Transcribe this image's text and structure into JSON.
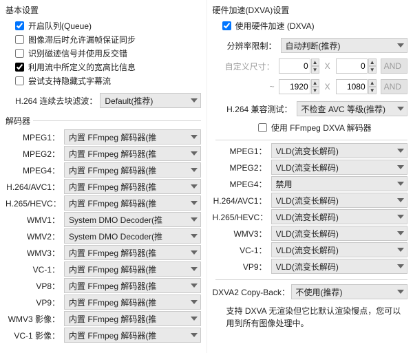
{
  "left": {
    "basic_title": "基本设置",
    "chk_queue": "开启队列(Queue)",
    "chk_framedrop": "图像滞后时允许漏帧保证同步",
    "chk_magnetics": "识别磁迹信号并使用反交错",
    "chk_highbit": "利用流中所定义的宽高比信息",
    "chk_hidden_sub": "尝试支持隐藏式字幕流",
    "label_deblock": "H.264 连续去块滤波：",
    "val_deblock": "Default(推荐)",
    "decoder_title": "解码器",
    "rows": [
      {
        "label": "MPEG1：",
        "val": "内置 FFmpeg 解码器(推"
      },
      {
        "label": "MPEG2：",
        "val": "内置 FFmpeg 解码器(推"
      },
      {
        "label": "MPEG4：",
        "val": "内置 FFmpeg 解码器(推"
      },
      {
        "label": "H.264/AVC1：",
        "val": "内置 FFmpeg 解码器(推"
      },
      {
        "label": "H.265/HEVC：",
        "val": "内置 FFmpeg 解码器(推"
      },
      {
        "label": "WMV1：",
        "val": "System DMO Decoder(推"
      },
      {
        "label": "WMV2：",
        "val": "System DMO Decoder(推"
      },
      {
        "label": "WMV3：",
        "val": "内置 FFmpeg 解码器(推"
      },
      {
        "label": "VC-1：",
        "val": "内置 FFmpeg 解码器(推"
      },
      {
        "label": "VP8：",
        "val": "内置 FFmpeg 解码器(推"
      },
      {
        "label": "VP9：",
        "val": "内置 FFmpeg 解码器(推"
      },
      {
        "label": "WMV3 影像：",
        "val": "内置 FFmpeg 解码器(推"
      },
      {
        "label": "VC-1 影像：",
        "val": "内置 FFmpeg 解码器(推"
      }
    ]
  },
  "right": {
    "dxva_title": "硬件加速(DXVA)设置",
    "chk_dxva": "使用硬件加速 (DXVA)",
    "label_reslimit": "分辨率限制：",
    "val_reslimit": "自动判断(推荐)",
    "label_customsize": "自定义尺寸：",
    "size_min_w": "0",
    "size_min_h": "0",
    "tilde": "~",
    "size_max_w": "1920",
    "size_max_h": "1080",
    "and_label": "AND",
    "x_label": "X",
    "label_compat": "H.264 兼容测试：",
    "val_compat": "不检查 AVC 等级(推荐)",
    "chk_ffmpeg_dxva": "使用 FFmpeg DXVA 解码器",
    "rows": [
      {
        "label": "MPEG1：",
        "val": "VLD(流变长解码)"
      },
      {
        "label": "MPEG2：",
        "val": "VLD(流变长解码)"
      },
      {
        "label": "MPEG4：",
        "val": "禁用"
      },
      {
        "label": "H.264/AVC1：",
        "val": "VLD(流变长解码)"
      },
      {
        "label": "H.265/HEVC：",
        "val": "VLD(流变长解码)"
      },
      {
        "label": "WMV3：",
        "val": "VLD(流变长解码)"
      },
      {
        "label": "VC-1：",
        "val": "VLD(流变长解码)"
      },
      {
        "label": "VP9：",
        "val": "VLD(流变长解码)"
      }
    ],
    "label_copyback": "DXVA2 Copy-Back：",
    "val_copyback": "不使用(推荐)",
    "hint": "支持 DXVA 无渲染但它比默认渲染慢点，您可以用到所有图像处理中。"
  }
}
